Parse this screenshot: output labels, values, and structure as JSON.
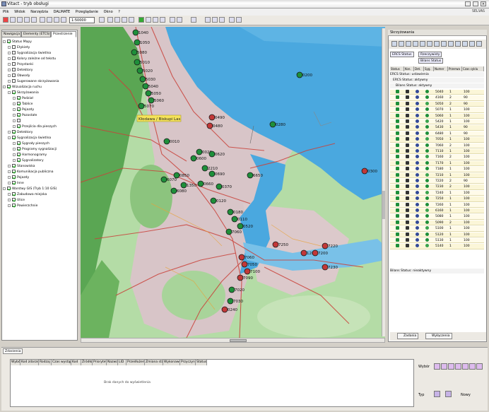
{
  "window": {
    "title": "Vitact - tryb obsługi"
  },
  "menu": [
    "Plik",
    "Widok",
    "Narzędzia",
    "DALMATE",
    "Przeglądanie",
    "Okno",
    "?"
  ],
  "logo": "SELVAS",
  "toolbar": {
    "scale_value": "1:50000"
  },
  "left_panel": {
    "tabs": [
      "Nawigacja",
      "Elementy (ETCS)",
      "Przestrzenie"
    ],
    "tree": [
      {
        "label": "Status Mapy",
        "level": 0,
        "checked": true
      },
      {
        "label": "Etykiety",
        "level": 1,
        "checked": false
      },
      {
        "label": "Sygnalizacja świetlna",
        "level": 1,
        "checked": false
      },
      {
        "label": "Kolory zależne od tekstu",
        "level": 1,
        "checked": false
      },
      {
        "label": "Przystanki",
        "level": 1,
        "checked": false
      },
      {
        "label": "Detektory",
        "level": 1,
        "checked": false
      },
      {
        "label": "Obwody",
        "level": 1,
        "checked": false
      },
      {
        "label": "Sugerowane skrzyżowania",
        "level": 1,
        "checked": false
      },
      {
        "label": "Wizualizacja ruchu",
        "level": 0,
        "checked": true
      },
      {
        "label": "Skrzyżowania",
        "level": 1,
        "checked": true
      },
      {
        "label": "Podział",
        "level": 2,
        "checked": true
      },
      {
        "label": "Tablice",
        "level": 2,
        "checked": true
      },
      {
        "label": "Pojazdy",
        "level": 2,
        "checked": true
      },
      {
        "label": "Pozostałe",
        "level": 2,
        "checked": true
      },
      {
        "label": "",
        "level": 2,
        "checked": false
      },
      {
        "label": "Przejścia dla pieszych",
        "level": 2,
        "checked": true
      },
      {
        "label": "Detektory",
        "level": 1,
        "checked": true
      },
      {
        "label": "Sygnalizacja świetlna",
        "level": 1,
        "checked": true
      },
      {
        "label": "Sygnały pieszych",
        "level": 2,
        "checked": true
      },
      {
        "label": "Programy sygnalizacji",
        "level": 2,
        "checked": true
      },
      {
        "label": "Harmonogramy",
        "level": 2,
        "checked": true
      },
      {
        "label": "Sygnalizatory",
        "level": 2,
        "checked": true
      },
      {
        "label": "Stanowiska",
        "level": 1,
        "checked": true
      },
      {
        "label": "Komunikacja publiczna",
        "level": 1,
        "checked": true
      },
      {
        "label": "Pojazdy",
        "level": 1,
        "checked": true
      },
      {
        "label": "Inne",
        "level": 1,
        "checked": true
      },
      {
        "label": "Warstwy GIS (Tryb 1:10 GIS)",
        "level": 0,
        "checked": true
      },
      {
        "label": "Zabudowa miejska",
        "level": 1,
        "checked": true
      },
      {
        "label": "Ulice",
        "level": 1,
        "checked": true
      },
      {
        "label": "Powierzchnie",
        "level": 1,
        "checked": true
      }
    ]
  },
  "map": {
    "district_label": "Kłodawa / Biskupi Las",
    "markers": [
      {
        "id": "1040",
        "color": "#1e8f3a"
      },
      {
        "id": "1050",
        "color": "#1e8f3a"
      },
      {
        "id": "5080",
        "color": "#1e8f3a"
      },
      {
        "id": "5010",
        "color": "#1e8f3a"
      },
      {
        "id": "5020",
        "color": "#1e8f3a"
      },
      {
        "id": "5030",
        "color": "#1e8f3a"
      },
      {
        "id": "5040",
        "color": "#1e8f3a"
      },
      {
        "id": "5050",
        "color": "#1e8f3a"
      },
      {
        "id": "5060",
        "color": "#1e8f3a"
      },
      {
        "id": "5070",
        "color": "#1e8f3a"
      },
      {
        "id": "0490",
        "color": "#c23838"
      },
      {
        "id": "0480",
        "color": "#c23838"
      },
      {
        "id": "0010",
        "color": "#1e8f3a"
      },
      {
        "id": "0020",
        "color": "#1e8f3a"
      },
      {
        "id": "0600",
        "color": "#1e8f3a"
      },
      {
        "id": "0620",
        "color": "#1e8f3a"
      },
      {
        "id": "0850",
        "color": "#1e8f3a"
      },
      {
        "id": "6070",
        "color": "#1e8f3a"
      },
      {
        "id": "2210",
        "color": "#1e8f3a"
      },
      {
        "id": "0690",
        "color": "#1e8f3a"
      },
      {
        "id": "0660",
        "color": "#1e8f3a"
      },
      {
        "id": "1350",
        "color": "#1e8f3a"
      },
      {
        "id": "6650",
        "color": "#1e8f3a"
      },
      {
        "id": "6080",
        "color": "#1e8f3a"
      },
      {
        "id": "0370",
        "color": "#1e8f3a"
      },
      {
        "id": "0120",
        "color": "#1e8f3a"
      },
      {
        "id": "0180",
        "color": "#1e8f3a"
      },
      {
        "id": "0110",
        "color": "#1e8f3a"
      },
      {
        "id": "0520",
        "color": "#1e8f3a"
      },
      {
        "id": "7060",
        "color": "#1e8f3a"
      },
      {
        "id": "0280",
        "color": "#1e8f3a"
      },
      {
        "id": "0200",
        "color": "#1e8f3a"
      },
      {
        "id": "7250",
        "color": "#c23838"
      },
      {
        "id": "1280",
        "color": "#c23838"
      },
      {
        "id": "7200",
        "color": "#c23838"
      },
      {
        "id": "7220",
        "color": "#c23838"
      },
      {
        "id": "7230",
        "color": "#c23838"
      },
      {
        "id": "7060",
        "color": "#c23838"
      },
      {
        "id": "7050",
        "color": "#c23838"
      },
      {
        "id": "7100",
        "color": "#c23838"
      },
      {
        "id": "7090",
        "color": "#c23838"
      },
      {
        "id": "7020",
        "color": "#1e8f3a"
      },
      {
        "id": "7030",
        "color": "#1e8f3a"
      },
      {
        "id": "0240",
        "color": "#c23838"
      },
      {
        "id": "0300",
        "color": "#c23838"
      }
    ]
  },
  "right_panel": {
    "header": "Skrzyżowania",
    "filter_chips": [
      "ERCS Status",
      "Rzeczywisty",
      "Bilans Status"
    ],
    "columns": [
      "Status",
      "Kon.",
      "Det.",
      "Syg.",
      "Numer",
      "Przerwa",
      "Czas cyklu"
    ],
    "groups": [
      "ERCS Status: ustawienia",
      "ERCS Status: aktywny",
      "Bilans Status: aktywny",
      "Bilans Status: nieaktywny"
    ],
    "rows": [
      {
        "number": "5040",
        "mode": "1",
        "cycle": "100"
      },
      {
        "number": "4160",
        "mode": "2",
        "cycle": "90"
      },
      {
        "number": "5050",
        "mode": "2",
        "cycle": "90"
      },
      {
        "number": "5070",
        "mode": "1",
        "cycle": "100"
      },
      {
        "number": "5060",
        "mode": "1",
        "cycle": "100"
      },
      {
        "number": "5420",
        "mode": "1",
        "cycle": "100"
      },
      {
        "number": "5430",
        "mode": "1",
        "cycle": "90"
      },
      {
        "number": "6480",
        "mode": "1",
        "cycle": "90"
      },
      {
        "number": "7050",
        "mode": "1",
        "cycle": "100"
      },
      {
        "number": "7060",
        "mode": "2",
        "cycle": "100"
      },
      {
        "number": "7110",
        "mode": "1",
        "cycle": "100"
      },
      {
        "number": "7160",
        "mode": "2",
        "cycle": "100"
      },
      {
        "number": "7170",
        "mode": "1",
        "cycle": "100"
      },
      {
        "number": "7180",
        "mode": "1",
        "cycle": "100"
      },
      {
        "number": "7210",
        "mode": "1",
        "cycle": "100"
      },
      {
        "number": "7220",
        "mode": "2",
        "cycle": "90"
      },
      {
        "number": "7230",
        "mode": "2",
        "cycle": "100"
      },
      {
        "number": "7240",
        "mode": "1",
        "cycle": "100"
      },
      {
        "number": "7250",
        "mode": "1",
        "cycle": "100"
      },
      {
        "number": "7260",
        "mode": "1",
        "cycle": "100"
      },
      {
        "number": "6160",
        "mode": "1",
        "cycle": "100"
      },
      {
        "number": "5080",
        "mode": "1",
        "cycle": "100"
      },
      {
        "number": "5090",
        "mode": "2",
        "cycle": "100"
      },
      {
        "number": "5100",
        "mode": "1",
        "cycle": "100"
      },
      {
        "number": "5120",
        "mode": "1",
        "cycle": "100"
      },
      {
        "number": "5130",
        "mode": "1",
        "cycle": "100"
      },
      {
        "number": "5140",
        "mode": "1",
        "cycle": "100"
      }
    ],
    "footer_buttons": [
      "Zadania",
      "Wyłączenia"
    ]
  },
  "bottom_panel": {
    "tab": "Zdarzenia",
    "columns": [
      "Wybór",
      "Kod zdarzenia",
      "Rodzaj",
      "Czas wystąpienia",
      "Kod",
      "Źródło",
      "Priorytet",
      "Nazwa",
      "LID",
      "Przedłużenie",
      "Zmiana stanu",
      "Wykonawca",
      "Przyczyna",
      "Status"
    ],
    "empty_message": "Brak danych do wyświetlenia",
    "filter_label": "Wybór",
    "type_label": "Typ",
    "new_label": "Nowy"
  },
  "colors": {
    "water": "#4aa8df",
    "forest": "#5aa653",
    "urban": "#d8c5c8",
    "park": "#a8d49a",
    "road": "#c9423a",
    "row_highlight": "#fbf6d8"
  }
}
